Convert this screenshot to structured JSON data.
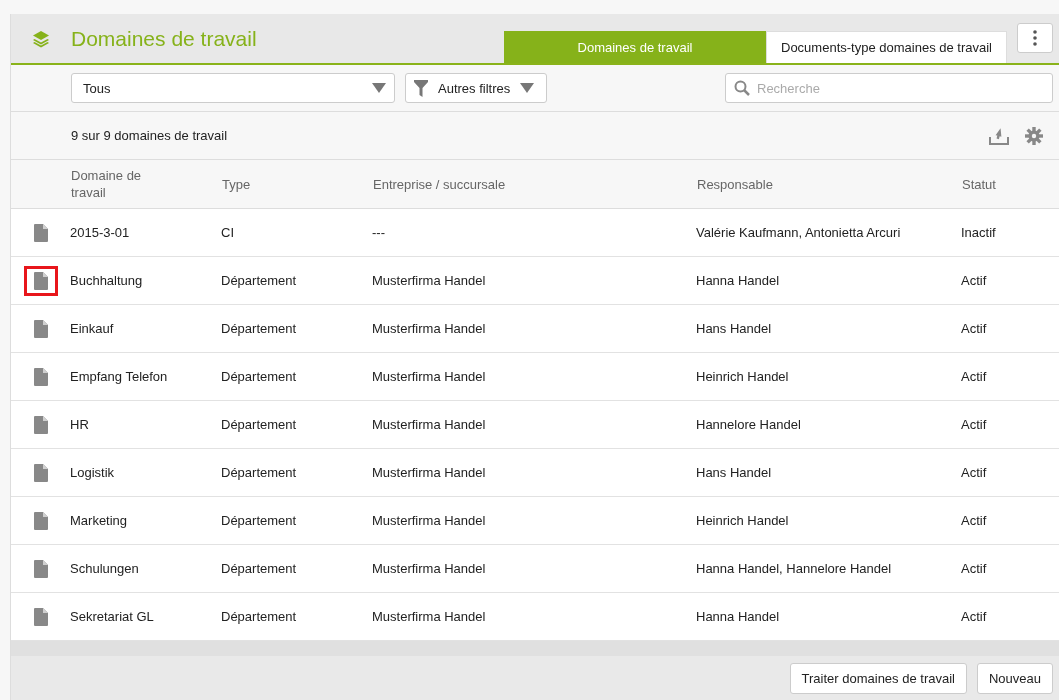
{
  "header": {
    "title": "Domaines de travail"
  },
  "tabs": [
    {
      "label": "Domaines de travail",
      "selected": true
    },
    {
      "label": "Documents-type domaines de travail",
      "selected": false
    }
  ],
  "filters": {
    "dropdown": {
      "value": "Tous"
    },
    "more_filters": "Autres filtres",
    "search": {
      "placeholder": "Recherche"
    }
  },
  "count": "9 sur 9 domaines de travail",
  "table": {
    "columns": [
      "Domaine de travail",
      "Type",
      "Entreprise / succursale",
      "Responsable",
      "Statut"
    ],
    "rows": [
      {
        "cells": [
          "2015-3-01",
          "CI",
          "---",
          "Valérie Kaufmann, Antonietta Arcuri",
          "Inactif"
        ],
        "highlighted": false
      },
      {
        "cells": [
          "Buchhaltung",
          "Département",
          "Musterfirma Handel",
          "Hanna Handel",
          "Actif"
        ],
        "highlighted": true
      },
      {
        "cells": [
          "Einkauf",
          "Département",
          "Musterfirma Handel",
          "Hans Handel",
          "Actif"
        ],
        "highlighted": false
      },
      {
        "cells": [
          "Empfang Telefon",
          "Département",
          "Musterfirma Handel",
          "Heinrich Handel",
          "Actif"
        ],
        "highlighted": false
      },
      {
        "cells": [
          "HR",
          "Département",
          "Musterfirma Handel",
          "Hannelore Handel",
          "Actif"
        ],
        "highlighted": false
      },
      {
        "cells": [
          "Logistik",
          "Département",
          "Musterfirma Handel",
          "Hans Handel",
          "Actif"
        ],
        "highlighted": false
      },
      {
        "cells": [
          "Marketing",
          "Département",
          "Musterfirma Handel",
          "Heinrich Handel",
          "Actif"
        ],
        "highlighted": false
      },
      {
        "cells": [
          "Schulungen",
          "Département",
          "Musterfirma Handel",
          "Hanna Handel, Hannelore Handel",
          "Actif"
        ],
        "highlighted": false
      },
      {
        "cells": [
          "Sekretariat GL",
          "Département",
          "Musterfirma Handel",
          "Hanna Handel",
          "Actif"
        ],
        "highlighted": false
      }
    ]
  },
  "footer": {
    "buttons": [
      "Traiter domaines de travail",
      "Nouveau"
    ]
  }
}
